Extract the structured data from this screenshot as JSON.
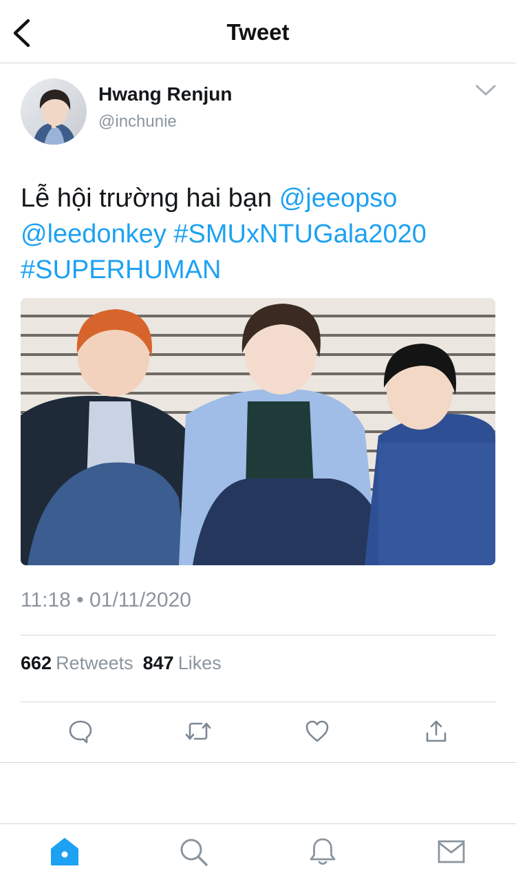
{
  "header": {
    "title": "Tweet",
    "back_icon": "chevron-left-icon"
  },
  "author": {
    "name": "Hwang Renjun",
    "handle": "@inchunie"
  },
  "tweet": {
    "text_plain": "Lễ hội trường hai bạn ",
    "mention_1": "@jeeopso",
    "mention_2": "@leedonkey",
    "hashtag_1": "#SMUxNTUGala2020",
    "hashtag_2": "#SUPERHUMAN",
    "timestamp": "11:18 • 01/11/2020"
  },
  "stats": {
    "retweets_count": "662",
    "retweets_label": "Retweets",
    "likes_count": "847",
    "likes_label": "Likes"
  },
  "actions": [
    "reply-icon",
    "retweet-icon",
    "like-icon",
    "share-icon"
  ],
  "tabbar": [
    "home-icon",
    "search-icon",
    "notifications-icon",
    "messages-icon"
  ],
  "colors": {
    "link": "#1da1f2",
    "muted": "#8a959e",
    "text": "#14171a",
    "divider": "#d3d6d9"
  }
}
